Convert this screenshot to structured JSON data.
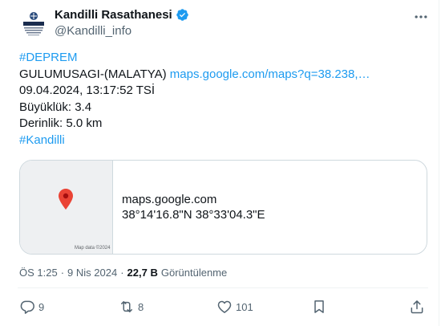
{
  "author": {
    "name": "Kandilli Rasathanesi",
    "handle": "@Kandilli_info",
    "avatar_text": "KANDILLI",
    "verified_color": "#1d9bf0"
  },
  "tweet": {
    "lines": [
      {
        "text": "#DEPREM",
        "link": true
      },
      {
        "text": "GULUMUSAGI-(MALATYA) ",
        "link_text": "maps.google.com/maps?q=38.238,…"
      },
      {
        "text": "09.04.2024, 13:17:52 TSİ"
      },
      {
        "text": "Büyüklük: 3.4"
      },
      {
        "text": "Derinlik: 5.0 km"
      },
      {
        "text": "#Kandilli",
        "link": true
      }
    ]
  },
  "card": {
    "domain": "maps.google.com",
    "title": "38°14'16.8\"N 38°33'04.3\"E",
    "map_attribution": "Map data ©2024"
  },
  "meta": {
    "time": "ÖS 1:25",
    "separator": "·",
    "date": "9 Nis 2024",
    "views_count": "22,7 B",
    "views_label": "Görüntülenme"
  },
  "actions": {
    "reply_count": "9",
    "retweet_count": "8",
    "like_count": "101"
  },
  "colors": {
    "accent": "#1d9bf0",
    "text": "#0f1419",
    "secondary": "#536471",
    "pin": "#ea4335"
  }
}
